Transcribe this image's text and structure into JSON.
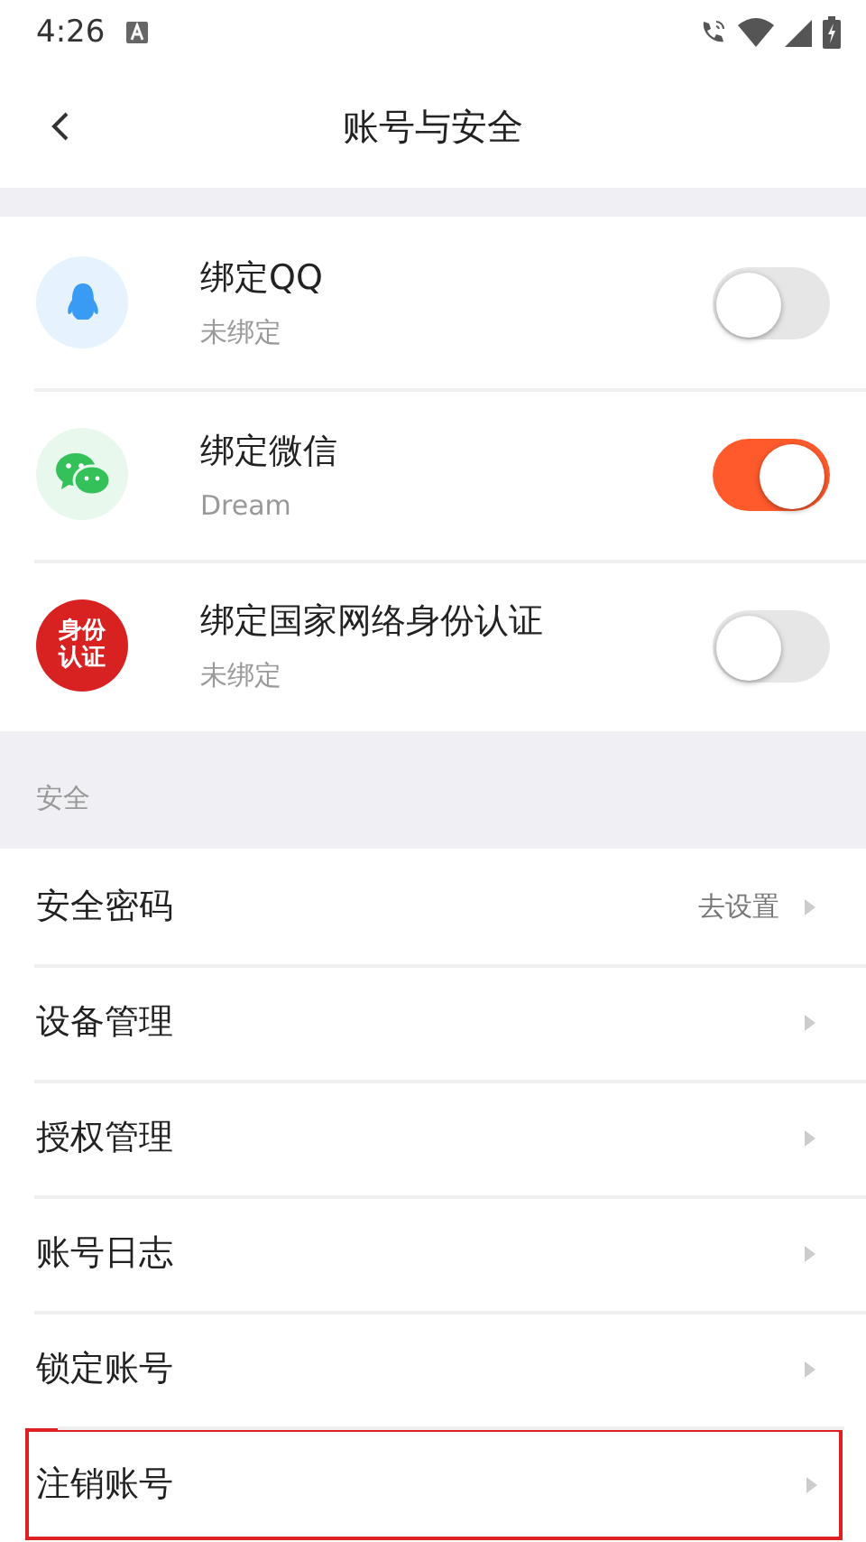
{
  "status_bar": {
    "time": "4:26"
  },
  "header": {
    "title": "账号与安全"
  },
  "bindings": [
    {
      "kind": "qq",
      "title": "绑定QQ",
      "subtitle": "未绑定",
      "on": false
    },
    {
      "kind": "wechat",
      "title": "绑定微信",
      "subtitle": "Dream",
      "on": true
    },
    {
      "kind": "id",
      "badge": "身份认证",
      "title": "绑定国家网络身份认证",
      "subtitle": "未绑定",
      "on": false
    }
  ],
  "security": {
    "heading": "安全",
    "items": [
      {
        "label": "安全密码",
        "value": "去设置",
        "highlighted": false
      },
      {
        "label": "设备管理",
        "highlighted": false
      },
      {
        "label": "授权管理",
        "highlighted": false
      },
      {
        "label": "账号日志",
        "highlighted": false
      },
      {
        "label": "锁定账号",
        "highlighted": false
      },
      {
        "label": "注销账号",
        "highlighted": true
      }
    ]
  }
}
